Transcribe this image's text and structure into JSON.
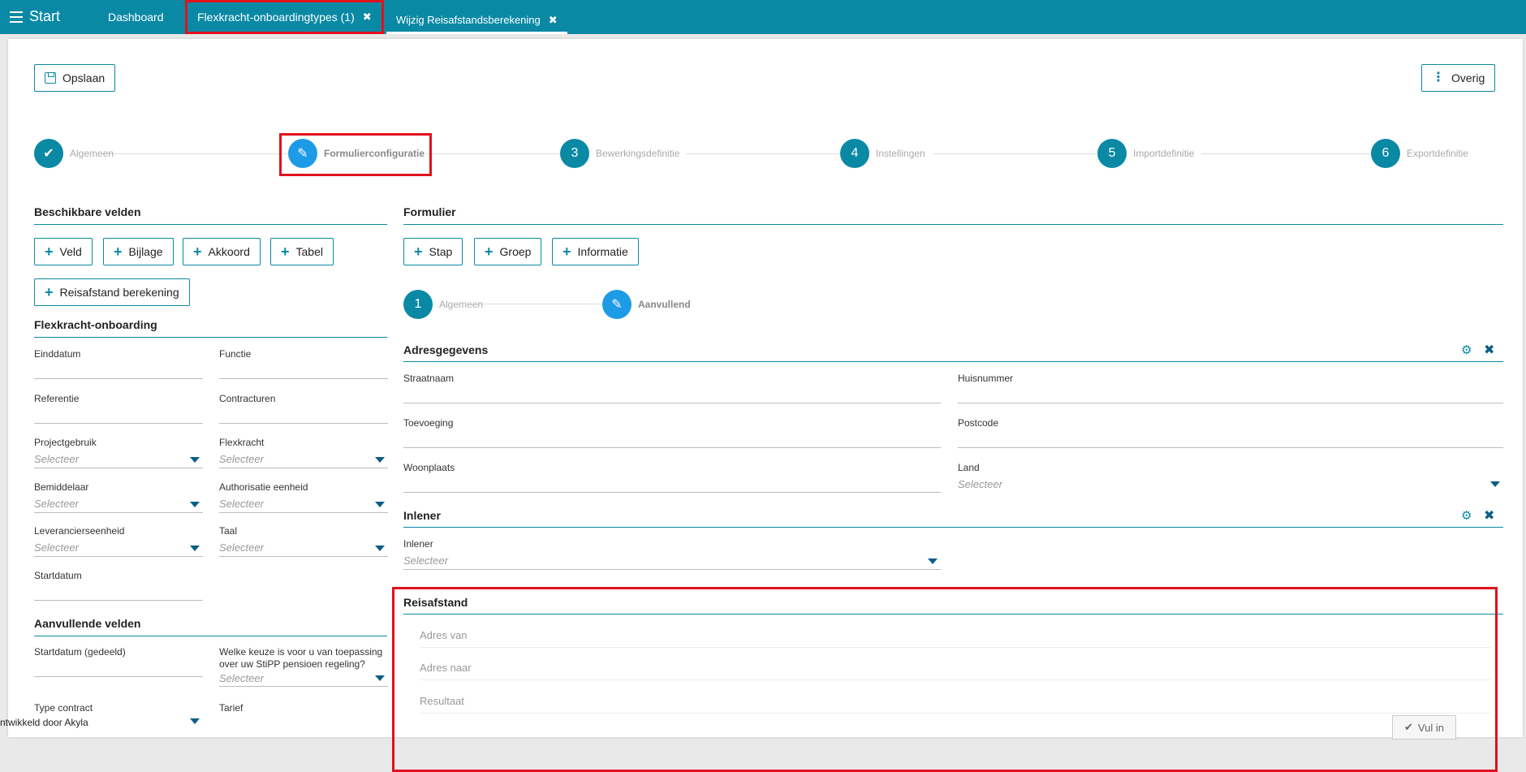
{
  "topbar": {
    "start_label": "Start",
    "tabs": [
      {
        "label": "Dashboard"
      },
      {
        "label": "Flexkracht-onboardingtypes (1)"
      },
      {
        "label": "Wijzig Reisafstandsberekening"
      }
    ]
  },
  "toolbar": {
    "save_label": "Opslaan",
    "more_label": "Overig"
  },
  "wizard": {
    "steps": [
      {
        "num": "",
        "label": "Algemeen"
      },
      {
        "num": "",
        "label": "Formulierconfiguratie"
      },
      {
        "num": "3",
        "label": "Bewerkingsdefinitie"
      },
      {
        "num": "4",
        "label": "Instellingen"
      },
      {
        "num": "5",
        "label": "Importdefinitie"
      },
      {
        "num": "6",
        "label": "Exportdefinitie"
      }
    ]
  },
  "available": {
    "title": "Beschikbare velden",
    "buttons": [
      "Veld",
      "Bijlage",
      "Akkoord",
      "Tabel",
      "Reisafstand berekening"
    ]
  },
  "onboarding": {
    "title": "Flexkracht-onboarding",
    "fields": [
      {
        "label": "Einddatum"
      },
      {
        "label": "Functie"
      },
      {
        "label": "Referentie"
      },
      {
        "label": "Contracturen"
      },
      {
        "label": "Projectgebruik",
        "placeholder": "Selecteer"
      },
      {
        "label": "Flexkracht",
        "placeholder": "Selecteer"
      },
      {
        "label": "Bemiddelaar",
        "placeholder": "Selecteer"
      },
      {
        "label": "Authorisatie eenheid",
        "placeholder": "Selecteer"
      },
      {
        "label": "Leverancierseenheid",
        "placeholder": "Selecteer"
      },
      {
        "label": "Taal",
        "placeholder": "Selecteer"
      },
      {
        "label": "Startdatum"
      }
    ]
  },
  "extra": {
    "title": "Aanvullende velden",
    "fields": [
      {
        "label": "Startdatum (gedeeld)"
      },
      {
        "label": "Welke keuze is voor u van toepassing over uw StiPP pensioen regeling?",
        "placeholder": "Selecteer"
      },
      {
        "label": "Type contract"
      },
      {
        "label": "Tarief"
      }
    ]
  },
  "footer": {
    "text": "ntwikkeld door Akyla"
  },
  "form": {
    "title": "Formulier",
    "buttons": [
      "Stap",
      "Groep",
      "Informatie"
    ],
    "substeps": [
      {
        "num": "1",
        "label": "Algemeen"
      },
      {
        "num": "",
        "label": "Aanvullend"
      }
    ],
    "adres": {
      "title": "Adresgegevens",
      "fields": [
        {
          "label": "Straatnaam"
        },
        {
          "label": "Huisnummer"
        },
        {
          "label": "Toevoeging"
        },
        {
          "label": "Postcode"
        },
        {
          "label": "Woonplaats"
        },
        {
          "label": "Land",
          "placeholder": "Selecteer"
        }
      ]
    },
    "inlener": {
      "title": "Inlener",
      "fields": [
        {
          "label": "Inlener",
          "placeholder": "Selecteer"
        }
      ]
    },
    "reisafstand": {
      "title": "Reisafstand",
      "rows": [
        "Adres van",
        "Adres naar",
        "Resultaat"
      ],
      "button": "Vul in"
    }
  }
}
